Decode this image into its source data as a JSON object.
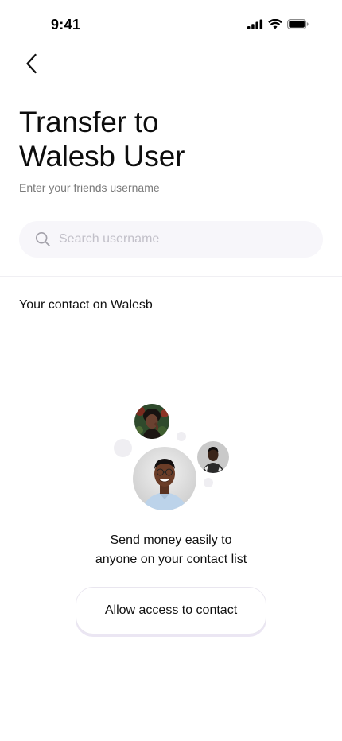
{
  "status_bar": {
    "time": "9:41"
  },
  "header": {
    "title_line1": "Transfer to",
    "title_line2": "Walesb User",
    "subtitle": "Enter your friends username"
  },
  "search": {
    "placeholder": "Search username",
    "value": ""
  },
  "contacts": {
    "section_label": "Your contact on Walesb",
    "empty_line1": "Send money easily to",
    "empty_line2": "anyone on your contact list",
    "allow_button_label": "Allow access to contact"
  },
  "icons": {
    "back": "chevron-left-icon",
    "search": "search-icon",
    "signal": "cellular-signal-icon",
    "wifi": "wifi-icon",
    "battery": "battery-icon"
  },
  "colors": {
    "search_bg": "#f7f6fa",
    "placeholder": "#c2c0c9",
    "subtitle": "#7a7a7a",
    "bubble": "#efeef2"
  }
}
